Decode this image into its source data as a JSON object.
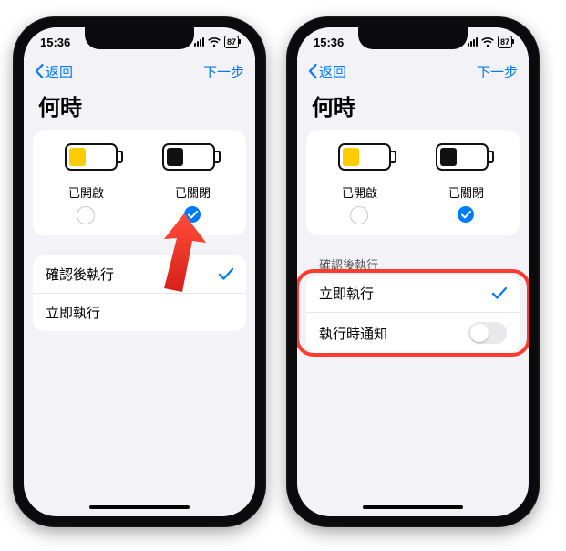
{
  "status": {
    "time": "15:36",
    "battery": "87"
  },
  "nav": {
    "back": "返回",
    "next": "下一步"
  },
  "title": "何時",
  "battery_options": {
    "on": {
      "label": "已開啟",
      "selected": false
    },
    "off": {
      "label": "已關閉",
      "selected": true
    }
  },
  "left_list": {
    "confirm": {
      "label": "確認後執行",
      "selected": true
    },
    "run": {
      "label": "立即執行",
      "selected": false
    }
  },
  "right_peek": "確認後執行",
  "right_list": {
    "run": {
      "label": "立即執行",
      "selected": true
    },
    "notify": {
      "label": "執行時通知",
      "toggled": false
    }
  }
}
